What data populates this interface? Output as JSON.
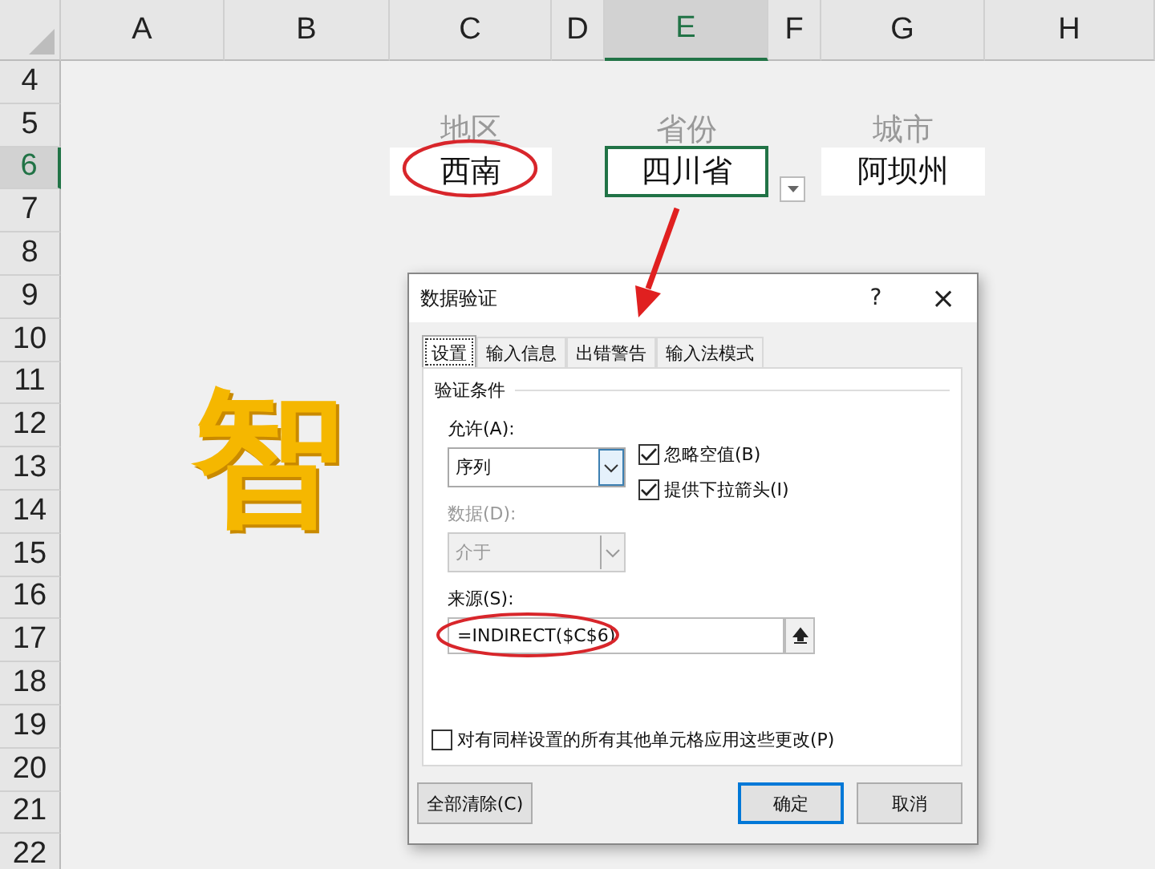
{
  "columns": [
    {
      "label": "A",
      "selected": false
    },
    {
      "label": "B",
      "selected": false
    },
    {
      "label": "C",
      "selected": false
    },
    {
      "label": "D",
      "selected": false
    },
    {
      "label": "E",
      "selected": true
    },
    {
      "label": "F",
      "selected": false
    },
    {
      "label": "G",
      "selected": false
    },
    {
      "label": "H",
      "selected": false
    }
  ],
  "rows": [
    {
      "label": "4",
      "selected": false
    },
    {
      "label": "5",
      "selected": false,
      "cells": [
        {},
        {},
        {
          "text": "地区",
          "kind": "label"
        },
        {},
        {
          "text": "省份",
          "kind": "label"
        },
        {},
        {
          "text": "城市",
          "kind": "label"
        },
        {}
      ]
    },
    {
      "label": "6",
      "selected": true,
      "cells": [
        {},
        {},
        {
          "text": "西南",
          "kind": "value",
          "selected": false
        },
        {},
        {
          "text": "四川省",
          "kind": "value",
          "selected": true
        },
        {},
        {
          "text": "阿坝州",
          "kind": "value",
          "selected": false
        },
        {}
      ]
    },
    {
      "label": "7",
      "selected": false
    },
    {
      "label": "8",
      "selected": false
    },
    {
      "label": "9",
      "selected": false
    },
    {
      "label": "10",
      "selected": false
    },
    {
      "label": "11",
      "selected": false
    },
    {
      "label": "12",
      "selected": false
    },
    {
      "label": "13",
      "selected": false
    },
    {
      "label": "14",
      "selected": false
    },
    {
      "label": "15",
      "selected": false
    },
    {
      "label": "16",
      "selected": false
    },
    {
      "label": "17",
      "selected": false
    },
    {
      "label": "18",
      "selected": false
    },
    {
      "label": "19",
      "selected": false
    },
    {
      "label": "20",
      "selected": false
    },
    {
      "label": "21",
      "selected": false
    },
    {
      "label": "22",
      "selected": false
    }
  ],
  "banner": [
    {
      "text": "智"
    }
  ],
  "dialog": {
    "title": "数据验证",
    "help": "?",
    "close": "×",
    "tabs": [
      {
        "label": "设置",
        "selected": true
      },
      {
        "label": "输入信息",
        "selected": false
      },
      {
        "label": "出错警告",
        "selected": false
      },
      {
        "label": "输入法模式",
        "selected": false
      }
    ],
    "group": "验证条件",
    "allow": {
      "label": "允许(A):",
      "value": "序列",
      "disabled": false
    },
    "data": {
      "label": "数据(D):",
      "value": "介于",
      "disabled": true
    },
    "options": [
      {
        "label": "忽略空值(B)",
        "checked": true
      },
      {
        "label": "提供下拉箭头(I)",
        "checked": true
      }
    ],
    "source": {
      "label": "来源(S):",
      "value": "=INDIRECT($C$6)"
    },
    "apply_all": {
      "label": "对有同样设置的所有其他单元格应用这些更改(P)",
      "checked": false
    },
    "buttons": [
      {
        "label": "全部清除(C)",
        "default": false
      },
      {
        "label": "确定",
        "default": true
      },
      {
        "label": "取消",
        "default": false
      }
    ]
  }
}
